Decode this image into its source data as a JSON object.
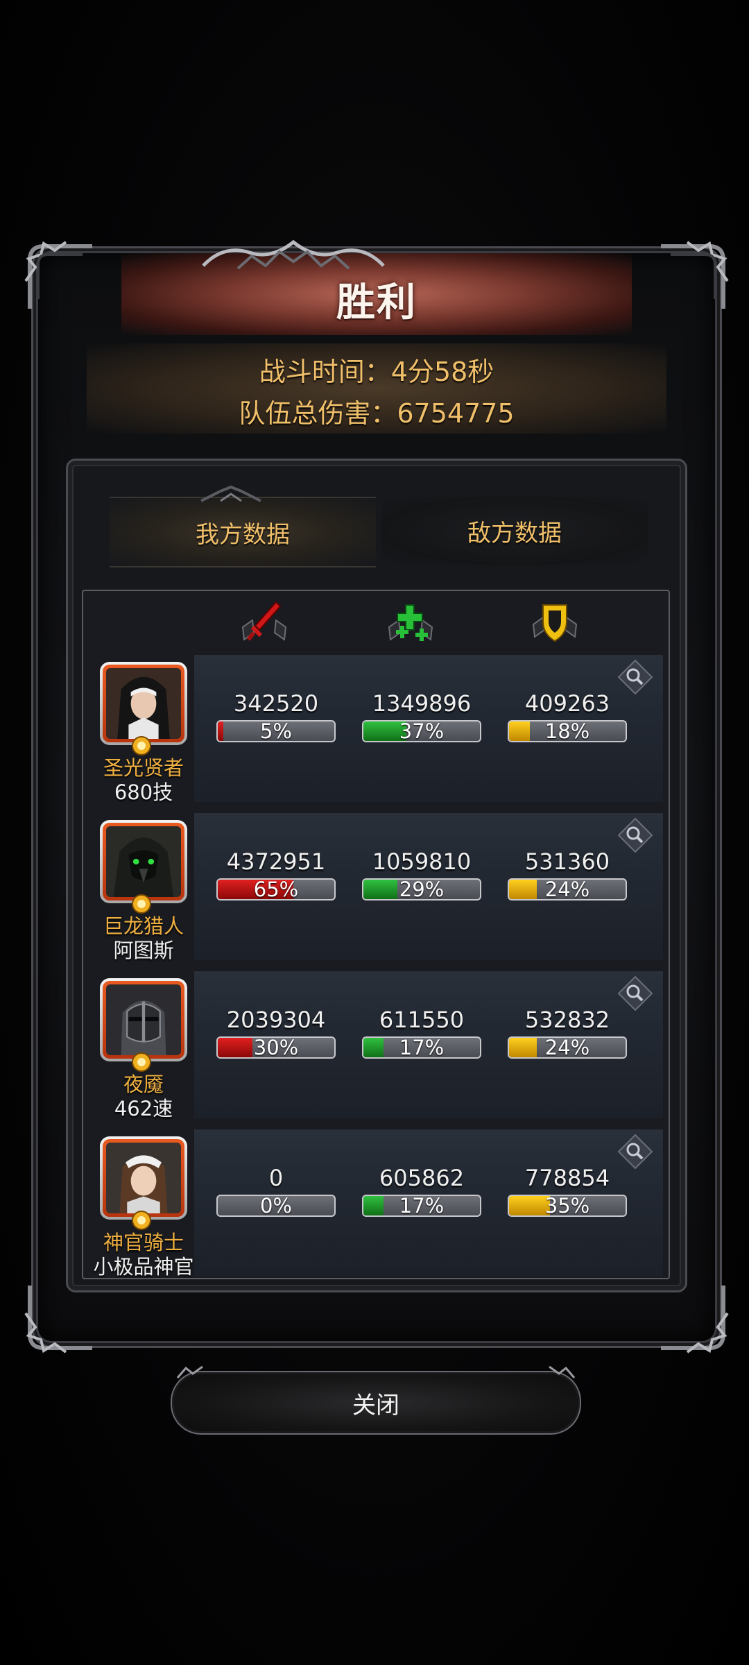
{
  "title": "胜利",
  "summary": {
    "battle_time": "战斗时间：4分58秒",
    "team_damage": "队伍总伤害：6754775"
  },
  "tabs": {
    "mine": "我方数据",
    "enemy": "敌方数据"
  },
  "stat_icons": [
    "sword-icon",
    "heal-cross-icon",
    "shield-icon"
  ],
  "colors": {
    "damage": "#d01818",
    "heal": "#28b038",
    "defense": "#f0c010",
    "gold_text": "#f0bf6a",
    "hero_name": "#f0b040"
  },
  "heroes": [
    {
      "name": "圣光贤者",
      "sub": "680技",
      "damage": {
        "value": "342520",
        "pct_label": "5%",
        "pct": 5
      },
      "heal": {
        "value": "1349896",
        "pct_label": "37%",
        "pct": 37
      },
      "defense": {
        "value": "409263",
        "pct_label": "18%",
        "pct": 18
      }
    },
    {
      "name": "巨龙猎人",
      "sub": "阿图斯",
      "damage": {
        "value": "4372951",
        "pct_label": "65%",
        "pct": 65
      },
      "heal": {
        "value": "1059810",
        "pct_label": "29%",
        "pct": 29
      },
      "defense": {
        "value": "531360",
        "pct_label": "24%",
        "pct": 24
      }
    },
    {
      "name": "夜魇",
      "sub": "462速",
      "damage": {
        "value": "2039304",
        "pct_label": "30%",
        "pct": 30
      },
      "heal": {
        "value": "611550",
        "pct_label": "17%",
        "pct": 17
      },
      "defense": {
        "value": "532832",
        "pct_label": "24%",
        "pct": 24
      }
    },
    {
      "name": "神官骑士",
      "sub": "小极品神官",
      "damage": {
        "value": "0",
        "pct_label": "0%",
        "pct": 0
      },
      "heal": {
        "value": "605862",
        "pct_label": "17%",
        "pct": 17
      },
      "defense": {
        "value": "778854",
        "pct_label": "35%",
        "pct": 35
      }
    }
  ],
  "close_label": "关闭"
}
